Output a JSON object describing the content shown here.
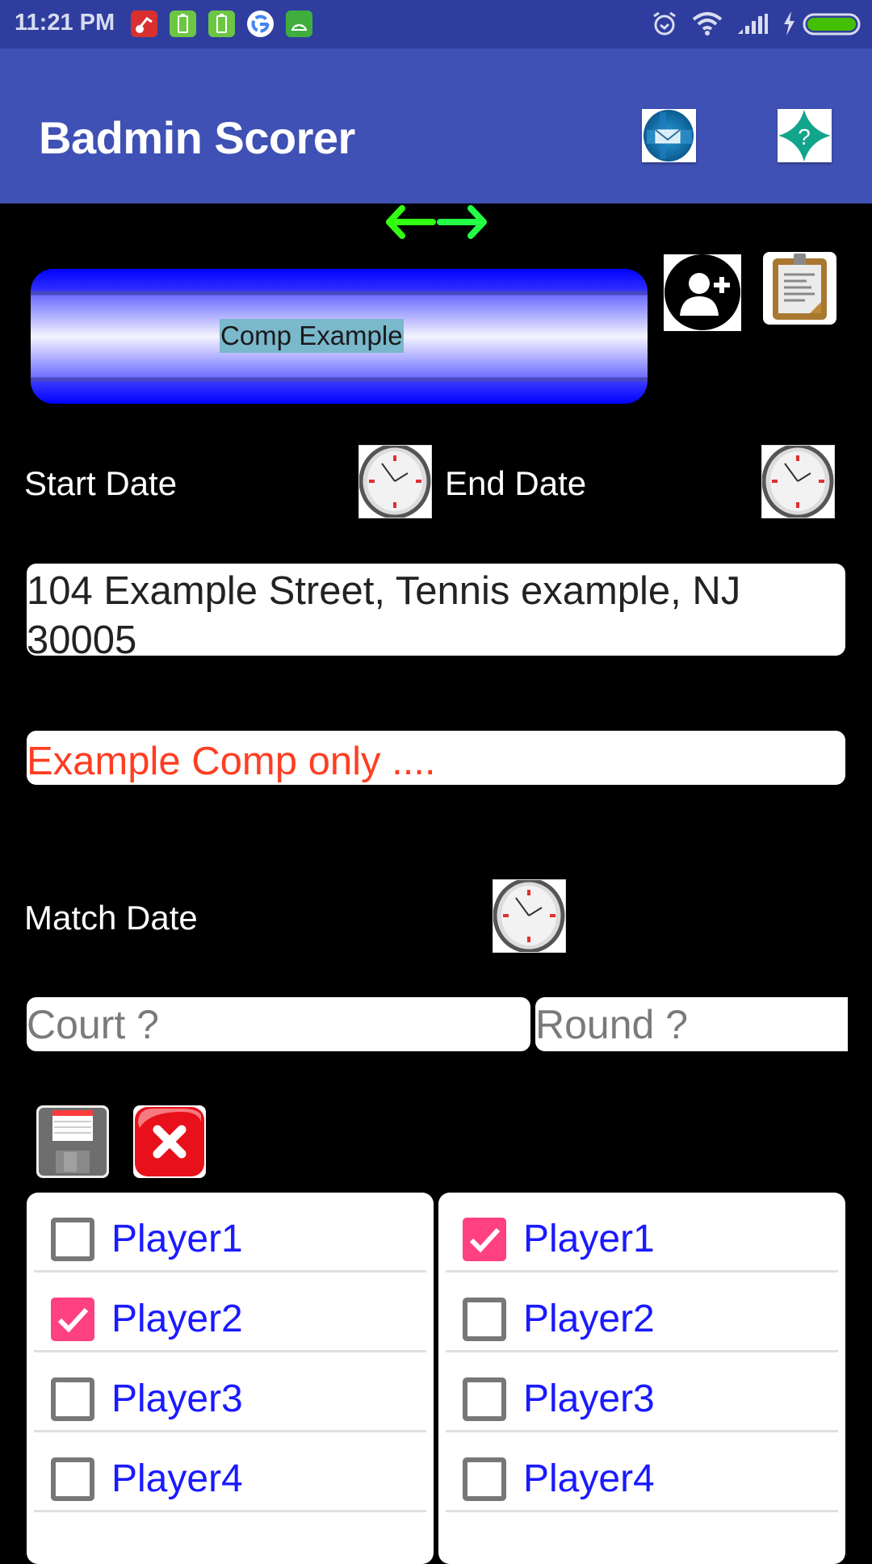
{
  "status_bar": {
    "time": "11:21 PM",
    "notification_icons": [
      "red-app-icon",
      "battery-notification-icon",
      "battery-notification-icon",
      "google-icon",
      "android-icon"
    ],
    "system_icons": [
      "alarm-icon",
      "wifi-icon",
      "signal-icon",
      "charging-icon",
      "battery-icon"
    ],
    "battery_color": "#44c000"
  },
  "app_bar": {
    "title": "Badmin Scorer",
    "actions": [
      {
        "name": "email",
        "icon": "mail-icon"
      },
      {
        "name": "help",
        "icon": "help-icon"
      }
    ],
    "color": "#3f51b5"
  },
  "competition": {
    "swap_icon": "swap-arrows-icon",
    "name": "Comp Example",
    "add_player_icon": "add-user-icon",
    "notes_icon": "clipboard-icon",
    "start_date_label": "Start Date",
    "end_date_label": "End Date",
    "address": "104 Example Street, Tennis example, NJ 30005",
    "note": "Example Comp only ...."
  },
  "match": {
    "date_label": "Match Date",
    "court_placeholder": "Court ?",
    "round_placeholder": "Round ?",
    "court_value": "",
    "round_value": ""
  },
  "actions": {
    "save_icon": "save-icon",
    "cancel_icon": "cancel-icon"
  },
  "teams": {
    "left": [
      {
        "name": "Player1",
        "checked": false
      },
      {
        "name": "Player2",
        "checked": true
      },
      {
        "name": "Player3",
        "checked": false
      },
      {
        "name": "Player4",
        "checked": false
      }
    ],
    "right": [
      {
        "name": "Player1",
        "checked": true
      },
      {
        "name": "Player2",
        "checked": false
      },
      {
        "name": "Player3",
        "checked": false
      },
      {
        "name": "Player4",
        "checked": false
      }
    ],
    "check_color": "#ff4081",
    "name_color": "#1a1aff"
  }
}
